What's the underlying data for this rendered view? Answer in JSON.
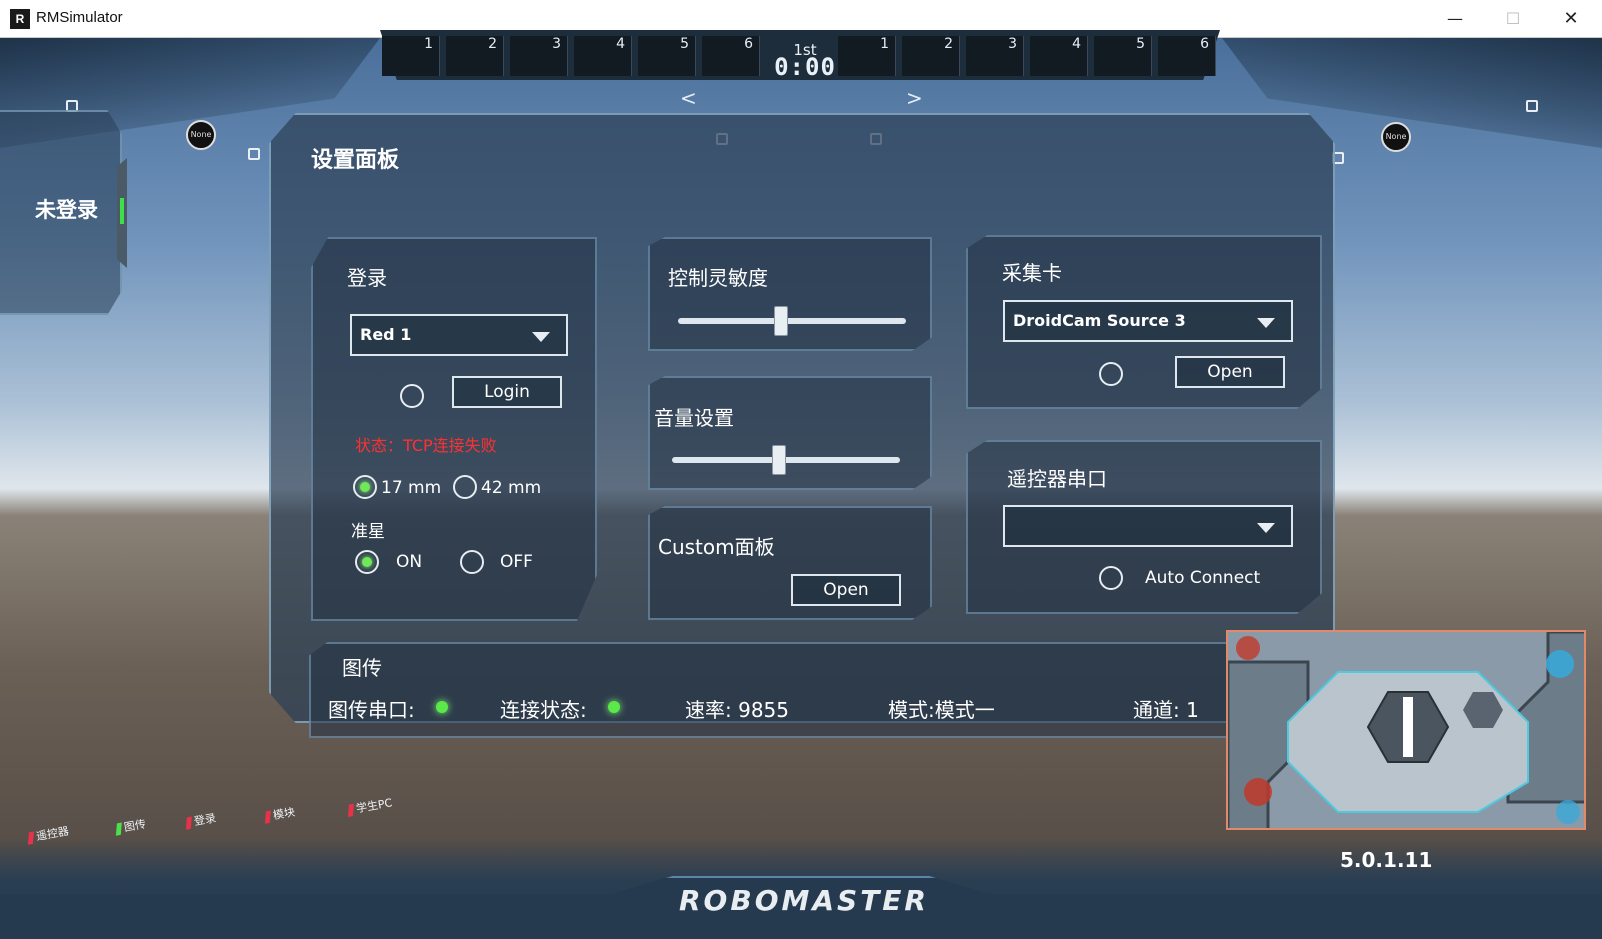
{
  "window": {
    "icon_glyph": "R",
    "title": "RMSimulator",
    "minimize_glyph": "—",
    "maximize_glyph": "☐",
    "close_glyph": "✕"
  },
  "hud": {
    "left_slots": [
      "1",
      "2",
      "3",
      "4",
      "5",
      "6"
    ],
    "right_slots": [
      "1",
      "2",
      "3",
      "4",
      "5",
      "6"
    ],
    "round": "1st",
    "timer": "0:00",
    "nav_prev": "<",
    "nav_next": ">",
    "left_badge": "None",
    "right_badge": "None"
  },
  "side_panel": {
    "status": "未登录"
  },
  "settings": {
    "title": "设置面板",
    "login": {
      "title": "登录",
      "robot_select_value": "Red 1",
      "login_button": "Login",
      "status": "状态：TCP连接失败",
      "caliber_options": [
        "17 mm",
        "42 mm"
      ],
      "caliber_selected": "17 mm",
      "crosshair_label": "准星",
      "crosshair_on": "ON",
      "crosshair_off": "OFF",
      "crosshair_selected": "ON"
    },
    "sensitivity": {
      "title": "控制灵敏度",
      "value": 0.45
    },
    "volume": {
      "title": "音量设置",
      "value": 0.47
    },
    "custom": {
      "title": "Custom面板",
      "open_button": "Open"
    },
    "capture_card": {
      "title": "采集卡",
      "source_value": "DroidCam Source 3",
      "open_button": "Open"
    },
    "remote_serial": {
      "title": "遥控器串口",
      "port_value": "",
      "auto_connect_label": "Auto Connect"
    },
    "image_transmission": {
      "title": "图传",
      "serial_label": "图传串口:",
      "connection_label": "连接状态:",
      "rate_label": "速率: 9855",
      "mode_label": "模式:模式一",
      "channel_label": "通道: 1"
    }
  },
  "indicators": [
    {
      "label": "遥控器",
      "color": "#e8324a"
    },
    {
      "label": "图传",
      "color": "#4ee04a"
    },
    {
      "label": "登录",
      "color": "#e8324a"
    },
    {
      "label": "模块",
      "color": "#e8324a"
    },
    {
      "label": "学生PC",
      "color": "#e8324a"
    }
  ],
  "version": "5.0.1.11",
  "brand": "ROBOMASTER",
  "colors": {
    "status_error": "#ff3030",
    "led_ok": "#5be84a",
    "panel_border": "#96bed7"
  }
}
